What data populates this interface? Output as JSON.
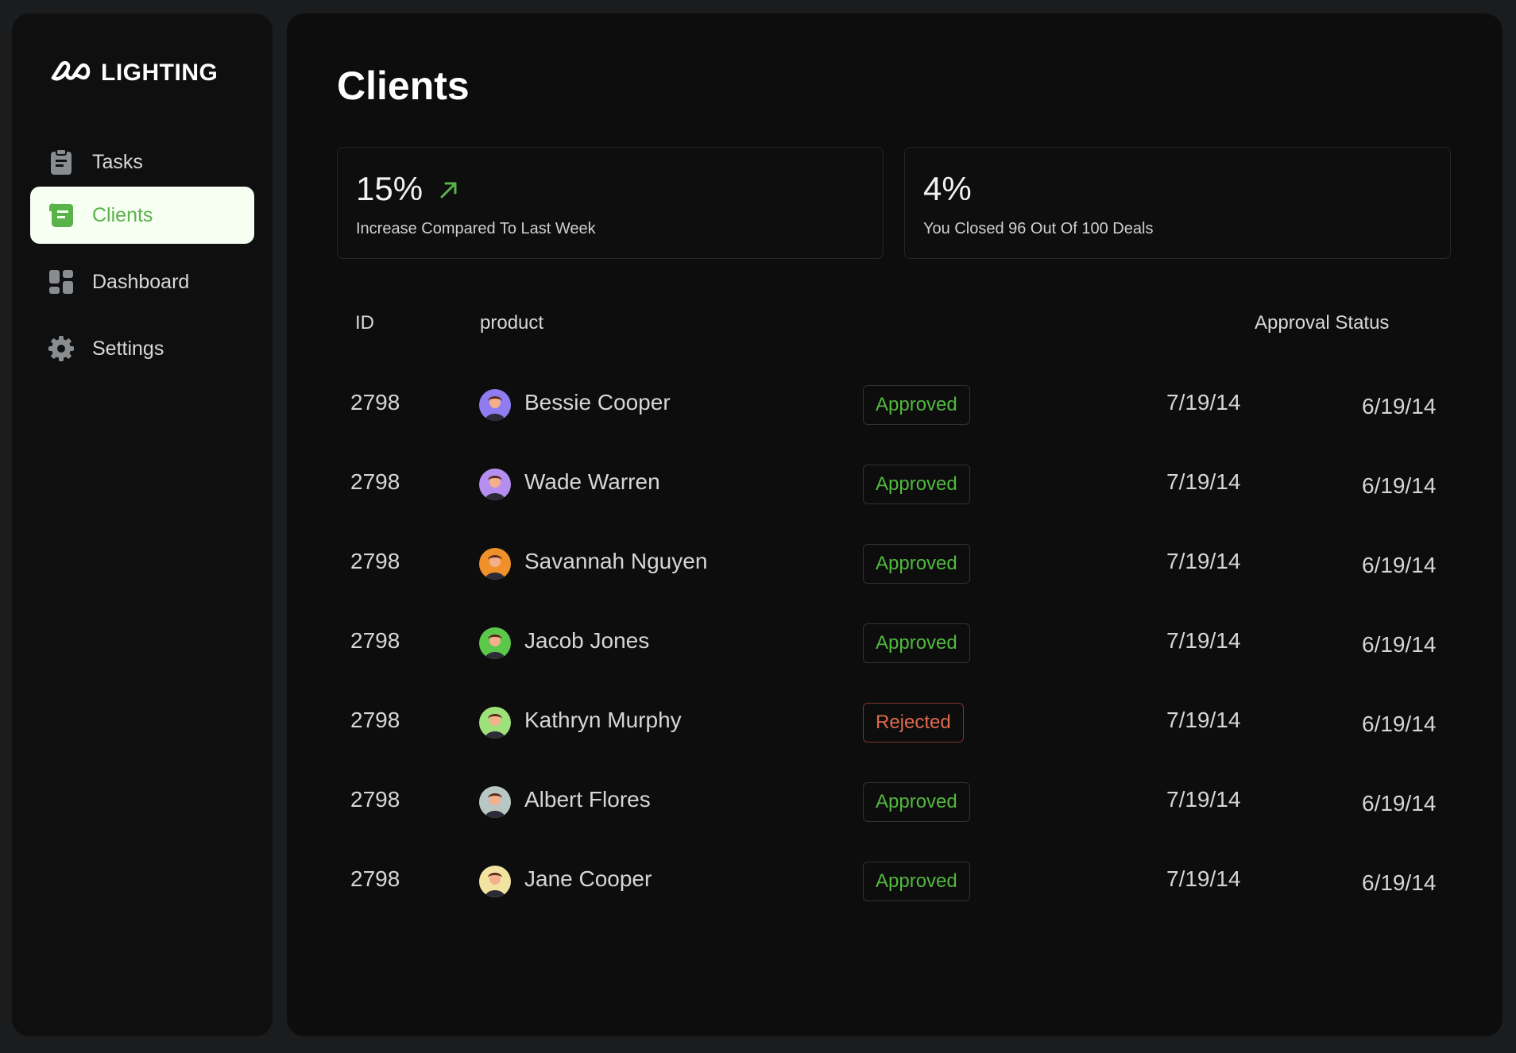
{
  "app": {
    "logo_text": "LIGHTING"
  },
  "sidebar": {
    "items": [
      {
        "label": "Tasks",
        "icon": "clipboard-icon",
        "active": false
      },
      {
        "label": "Clients",
        "icon": "scroll-icon",
        "active": true
      },
      {
        "label": "Dashboard",
        "icon": "dashboard-icon",
        "active": false
      },
      {
        "label": "Settings",
        "icon": "gear-icon",
        "active": false
      }
    ]
  },
  "main": {
    "title": "Clients",
    "stats": [
      {
        "value": "15%",
        "description": "Increase Compared To Last Week",
        "trend_icon": "arrow-up-right-icon"
      },
      {
        "value": "4%",
        "description": "You Closed 96 Out Of 100 Deals"
      }
    ],
    "table": {
      "headers": {
        "id": "ID",
        "product": "product",
        "approval": "Approval Status"
      },
      "rows": [
        {
          "id": "2798",
          "name": "Bessie Cooper",
          "status": "Approved",
          "date1": "7/19/14",
          "date2": "6/19/14"
        },
        {
          "id": "2798",
          "name": "Wade Warren",
          "status": "Approved",
          "date1": "7/19/14",
          "date2": "6/19/14"
        },
        {
          "id": "2798",
          "name": "Savannah Nguyen",
          "status": "Approved",
          "date1": "7/19/14",
          "date2": "6/19/14"
        },
        {
          "id": "2798",
          "name": "Jacob Jones",
          "status": "Approved",
          "date1": "7/19/14",
          "date2": "6/19/14"
        },
        {
          "id": "2798",
          "name": "Kathryn Murphy",
          "status": "Rejected",
          "date1": "7/19/14",
          "date2": "6/19/14"
        },
        {
          "id": "2798",
          "name": "Albert Flores",
          "status": "Approved",
          "date1": "7/19/14",
          "date2": "6/19/14"
        },
        {
          "id": "2798",
          "name": "Jane Cooper",
          "status": "Approved",
          "date1": "7/19/14",
          "date2": "6/19/14"
        }
      ]
    }
  },
  "colors": {
    "accent_green": "#5ab24a",
    "approved": "#52b83f",
    "rejected": "#e06a4c",
    "avatar_backgrounds": [
      "#8e7cf0",
      "#b58ef0",
      "#f0902a",
      "#5cc84a",
      "#9ee07a",
      "#b9c7c4",
      "#f2e3a0"
    ]
  }
}
